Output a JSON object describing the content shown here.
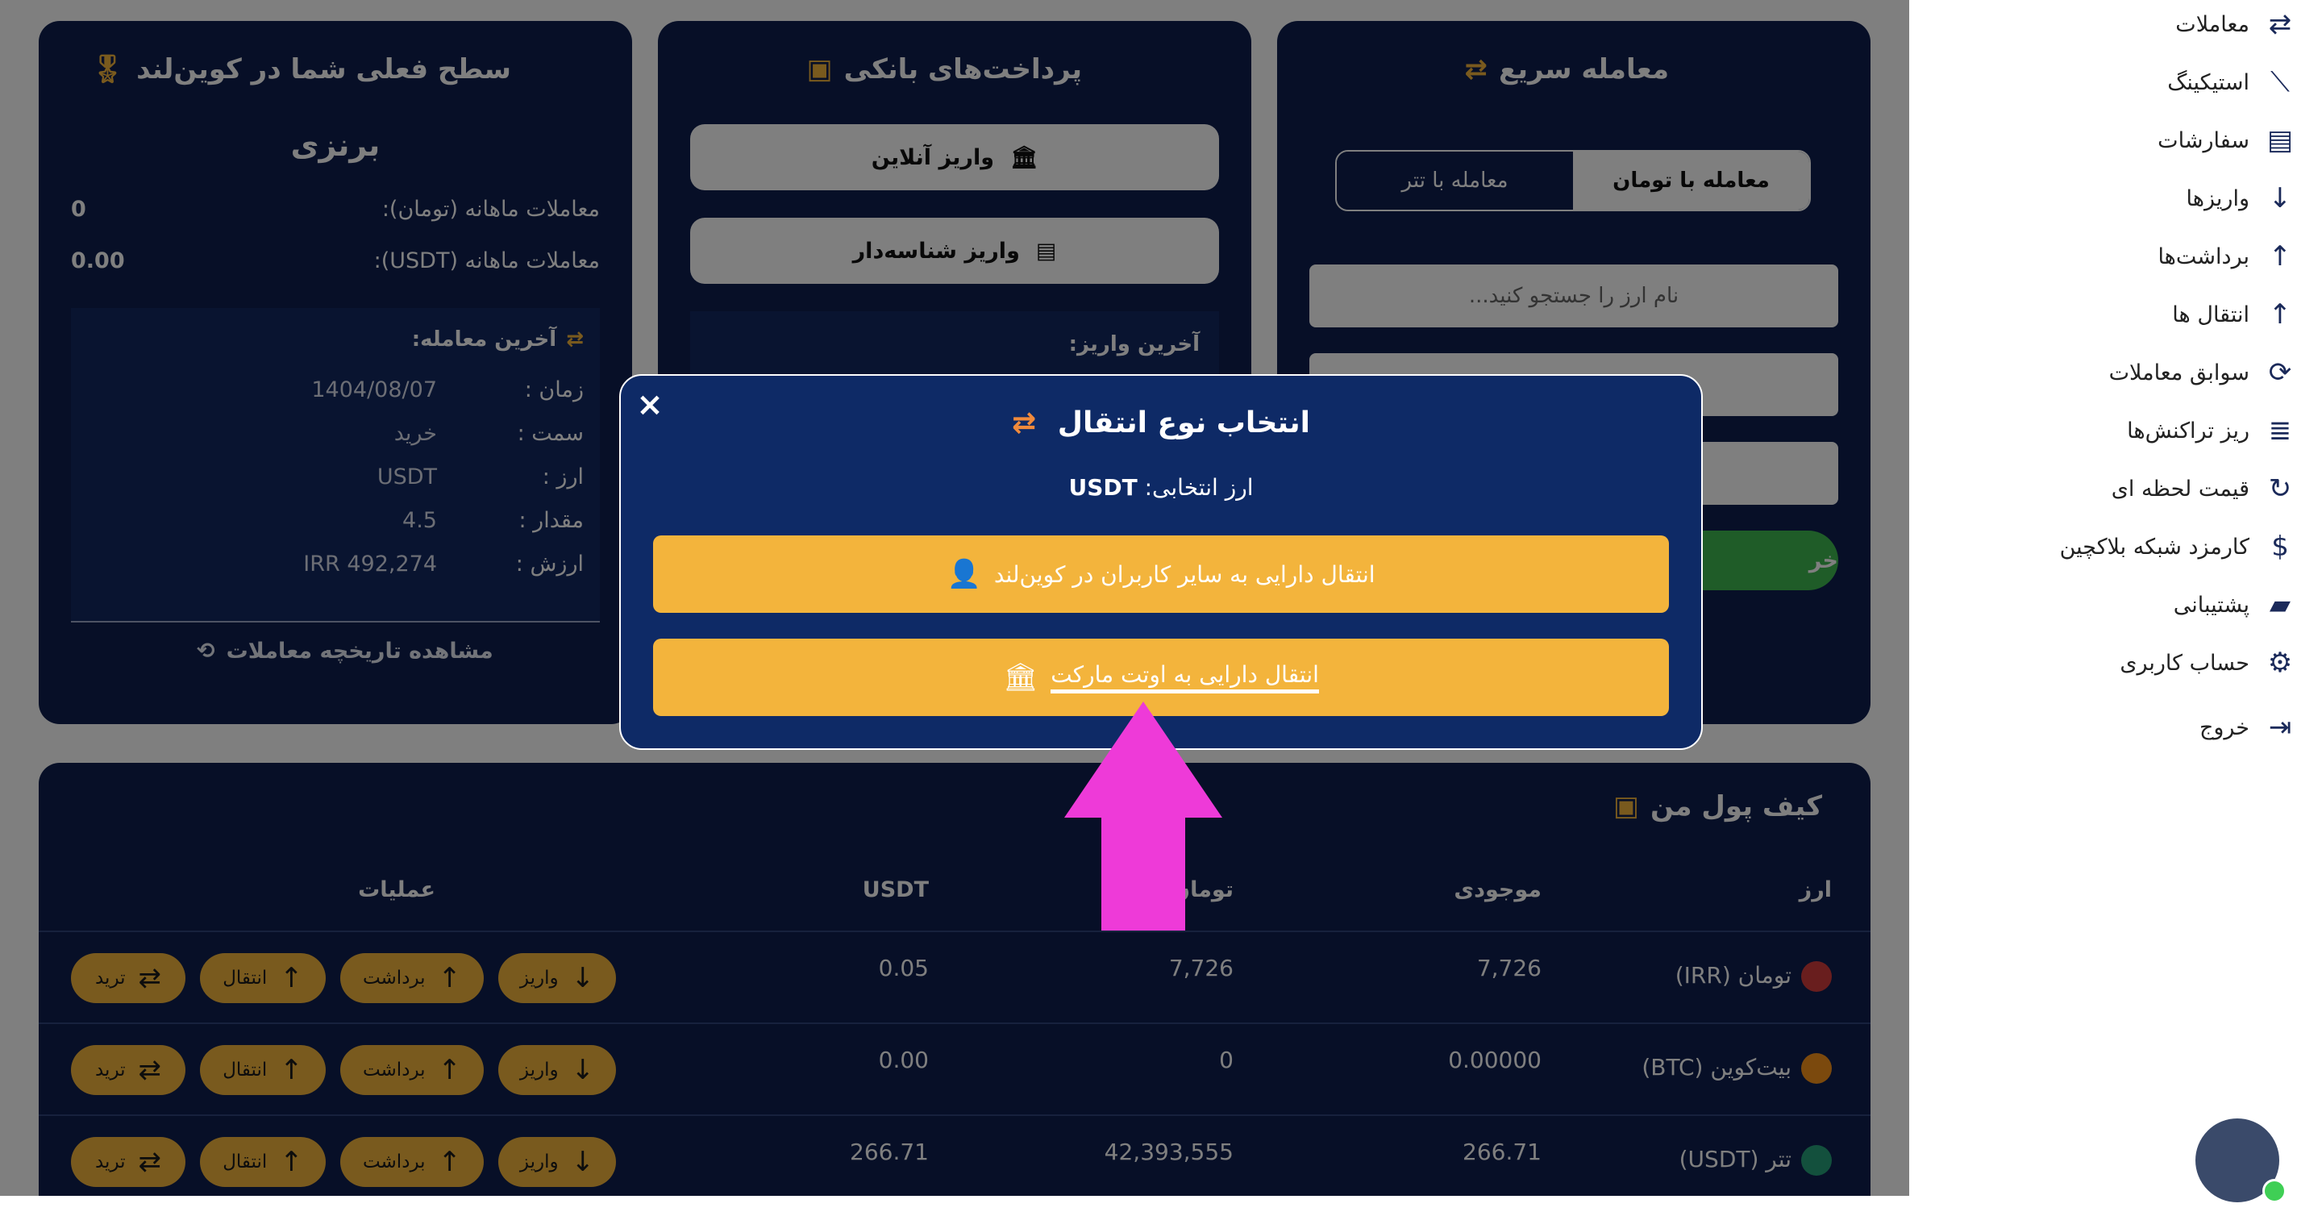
{
  "sidebar": {
    "items": [
      {
        "label": "معاملات",
        "icon": "exchange-icon"
      },
      {
        "label": "استیکینگ",
        "icon": "chart-icon"
      },
      {
        "label": "سفارشات",
        "icon": "clipboard-icon"
      },
      {
        "label": "واریزها",
        "icon": "arrow-down-icon"
      },
      {
        "label": "برداشت‌ها",
        "icon": "arrow-up-icon"
      },
      {
        "label": "انتقال ها",
        "icon": "arrow-up-icon"
      },
      {
        "label": "سوابق معاملات",
        "icon": "history-icon"
      },
      {
        "label": "ریز تراکنش‌ها",
        "icon": "list-icon"
      },
      {
        "label": "قیمت لحظه ای",
        "icon": "refresh-icon"
      },
      {
        "label": "کارمزد شبکه بلاکچین",
        "icon": "dollar-icon"
      },
      {
        "label": "پشتیبانی",
        "icon": "chat-icon"
      },
      {
        "label": "حساب کاربری",
        "icon": "gear-icon"
      },
      {
        "label": "خروج",
        "icon": "logout-icon"
      }
    ]
  },
  "quick_trade": {
    "title": "معامله سریع",
    "tab_toman": "معامله با تومان",
    "tab_tether": "معامله با تتر",
    "search_placeholder": "نام ارز را جستجو کنید...",
    "buy_label": "خر"
  },
  "bank": {
    "title": "پرداخت‌های بانکی",
    "online_deposit": "واریز آنلاین",
    "id_deposit": "واریز شناسه‌دار",
    "last_deposit": "آخرین واریز:"
  },
  "level": {
    "title": "سطح فعلی شما در کوین‌لند",
    "level_name": "برنزی",
    "monthly_toman_label": "معاملات ماهانه (تومان):",
    "monthly_toman_value": "0",
    "monthly_usdt_label": "معاملات ماهانه (USDT):",
    "monthly_usdt_value": "0.00",
    "last_trade_title": "آخرین معامله:",
    "last_trade": [
      {
        "label": "زمان :",
        "value": "1404/08/07"
      },
      {
        "label": "سمت :",
        "value": "خرید"
      },
      {
        "label": "ارز :",
        "value": "USDT"
      },
      {
        "label": "مقدار :",
        "value": "4.5"
      },
      {
        "label": "ارزش :",
        "value": "IRR 492,274"
      }
    ],
    "history_link": "مشاهده تاریخچه معاملات"
  },
  "wallet": {
    "title": "کیف پول من",
    "columns": [
      "ارز",
      "موجودی",
      "تومان",
      "USDT",
      "عملیات"
    ],
    "rows": [
      {
        "currency": "تومان (IRR)",
        "balance": "7,726",
        "toman": "7,726",
        "usdt": "0.05",
        "coin_color": "#d33c3c"
      },
      {
        "currency": "بیت‌کوین (BTC)",
        "balance": "0.00000",
        "toman": "0",
        "usdt": "0.00",
        "coin_color": "#f7931a"
      },
      {
        "currency": "تتر (USDT)",
        "balance": "266.71",
        "toman": "42,393,555",
        "usdt": "266.71",
        "coin_color": "#26a17b"
      }
    ],
    "actions": {
      "deposit": "واریز",
      "withdraw": "برداشت",
      "transfer": "انتقال",
      "trade": "ترید"
    }
  },
  "modal": {
    "title": "انتخاب نوع انتقال",
    "selected_label": "ارز انتخابی:",
    "selected_value": "USDT",
    "option_users": "انتقال دارایی به سایر کاربران در کوین‌لند",
    "option_otc": "انتقال دارایی به اوتت مارکت",
    "close": "×"
  },
  "colors": {
    "panel": "#0e1f4f",
    "modal": "#0e2a66",
    "accent": "#f3b43c",
    "highlight_arrow": "#ee3ad8",
    "buy_green": "#3fb950"
  }
}
